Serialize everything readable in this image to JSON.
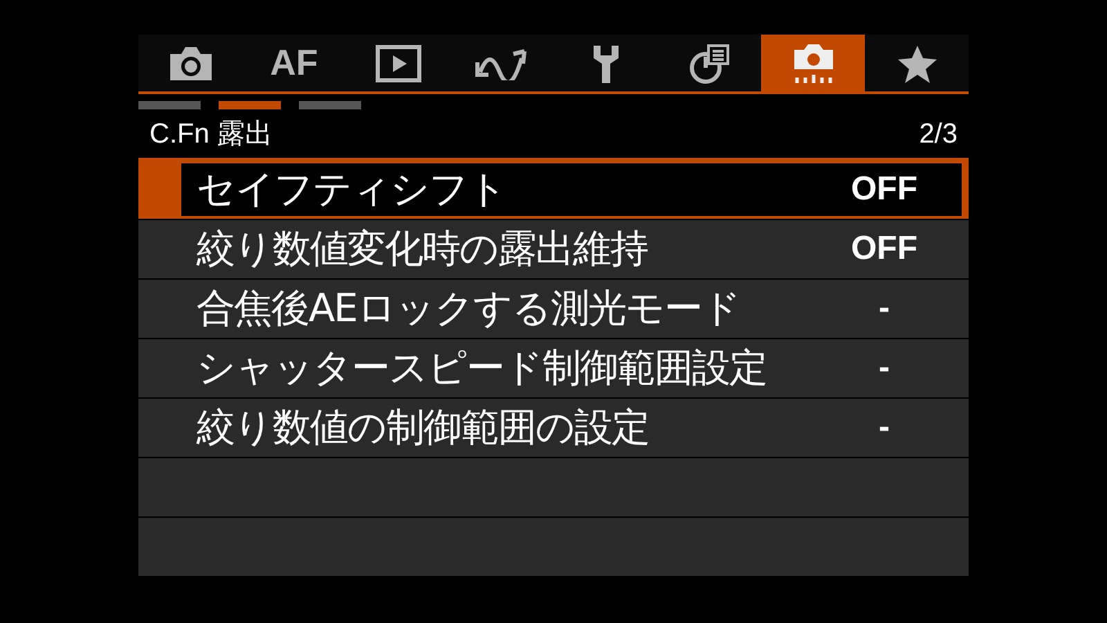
{
  "tabs": [
    {
      "kind": "camera",
      "selected": false
    },
    {
      "kind": "text",
      "label": "AF",
      "selected": false
    },
    {
      "kind": "play",
      "selected": false
    },
    {
      "kind": "wave",
      "selected": false
    },
    {
      "kind": "wrench",
      "selected": false
    },
    {
      "kind": "chart",
      "selected": false
    },
    {
      "kind": "custom",
      "selected": true
    },
    {
      "kind": "star",
      "selected": false
    }
  ],
  "pages": [
    {
      "selected": false
    },
    {
      "selected": true
    },
    {
      "selected": false
    }
  ],
  "header": {
    "title": "C.Fn 露出",
    "page": "2/3"
  },
  "rows": [
    {
      "label": "セイフティシフト",
      "value": "OFF",
      "selected": true
    },
    {
      "label": "絞り数値変化時の露出維持",
      "value": "OFF",
      "selected": false
    },
    {
      "label": "合焦後AEロックする測光モード",
      "value": "-",
      "selected": false
    },
    {
      "label": "シャッタースピード制御範囲設定",
      "value": "-",
      "selected": false
    },
    {
      "label": "絞り数値の制御範囲の設定",
      "value": "-",
      "selected": false
    }
  ]
}
